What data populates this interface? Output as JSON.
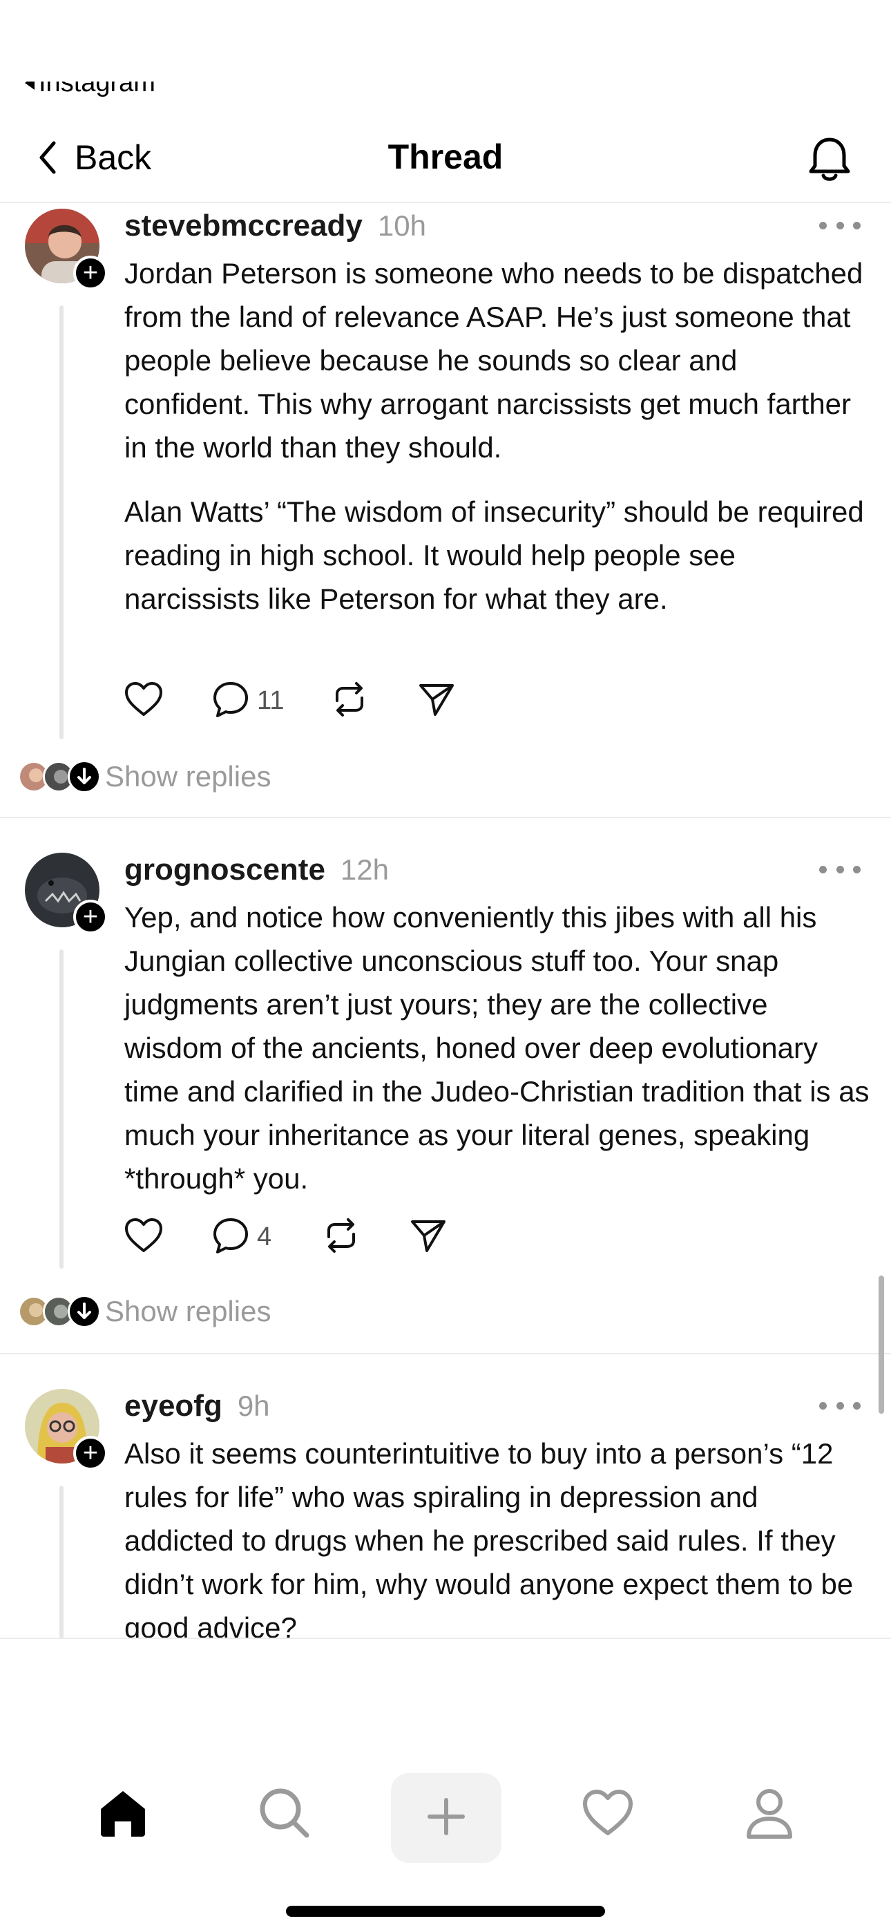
{
  "status": {
    "back_app": "Instagram"
  },
  "nav": {
    "back_label": "Back",
    "title": "Thread"
  },
  "posts": [
    {
      "username": "stevebmccready",
      "time": "10h",
      "paragraphs": [
        "Jordan Peterson is someone who needs to be dispatched from the land of relevance ASAP. He’s just someone that people believe because he sounds so clear and confident. This why arrogant narcissists get much farther in the world than they should.",
        "Alan Watts’ “The wisdom of insecurity” should be required reading in high school. It would help people see narcissists like Peterson for what they are."
      ],
      "reply_count": "11",
      "show_replies": "Show replies"
    },
    {
      "username": "grognoscente",
      "time": "12h",
      "paragraphs": [
        "Yep, and notice how conveniently this jibes with all his Jungian collective unconscious stuff too. Your snap judgments aren’t just yours; they are the collective wisdom of the ancients, honed over deep evolutionary time and clarified in the Judeo-Christian tradition that is as much your inheritance as your literal genes, speaking *through* you."
      ],
      "reply_count": "4",
      "show_replies": "Show replies"
    },
    {
      "username": "eyeofg",
      "time": "9h",
      "paragraphs": [
        "Also it seems counterintuitive to buy into a person’s “12 rules for life” who was spiraling in depression and addicted to drugs when he prescribed said rules. If they didn’t work for him, why would anyone expect them to be good advice?"
      ]
    }
  ],
  "tabbar": {
    "tabs": [
      "home-icon",
      "search-icon",
      "create-plus-icon",
      "activity-heart-icon",
      "profile-icon"
    ],
    "active": "home-icon"
  },
  "colors": {
    "accent": "#000000",
    "muted_text": "#9a9a9a",
    "divider": "#ececec"
  }
}
